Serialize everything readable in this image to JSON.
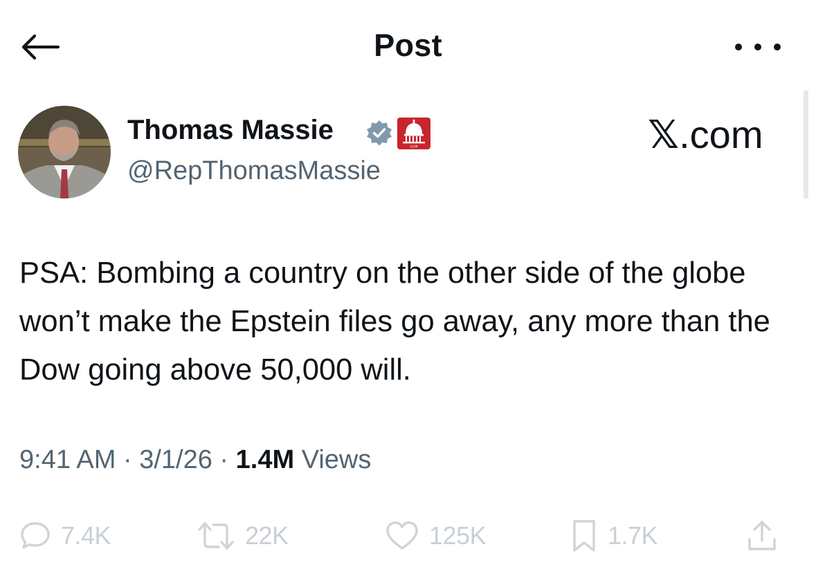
{
  "header": {
    "title": "Post",
    "back_icon": "arrow-left-icon",
    "more_icon": "more-dots-icon"
  },
  "author": {
    "name": "Thomas Massie",
    "handle": "@RepThomasMassie",
    "verified_icon": "verified-badge-icon",
    "affiliation_badge": "house-gop-badge",
    "affiliation_badge_text": "HOUSE GOP"
  },
  "source_watermark": {
    "x": "𝕏",
    "domain": ".com"
  },
  "tweet": {
    "text": "PSA: Bombing a country on the other side of the globe won’t make the Epstein files go away, any more than the Dow going above 50,000 will.",
    "time": "9:41 AM",
    "separator": "·",
    "date": "3/1/26",
    "views_count": "1.4M",
    "views_label": "Views"
  },
  "actions": {
    "replies": "7.4K",
    "reposts": "22K",
    "likes": "125K",
    "bookmarks": "1.7K",
    "share_icon": "share-icon"
  },
  "colors": {
    "text_primary": "#0f1419",
    "text_secondary": "#536471",
    "action_muted": "#cfd4d8",
    "verified_fill": "#829aab",
    "affiliation_red": "#c7262d"
  }
}
